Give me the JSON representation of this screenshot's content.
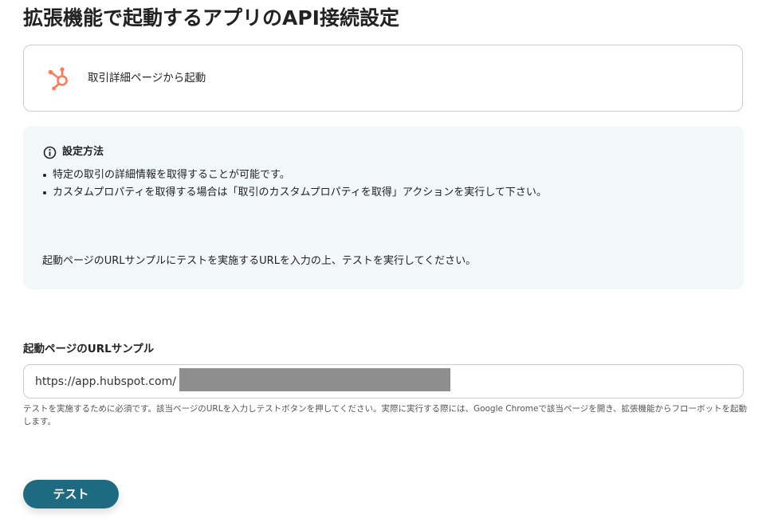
{
  "page": {
    "title": "拡張機能で起動するアプリのAPI接続設定"
  },
  "trigger": {
    "icon": "hubspot-logo-icon",
    "label": "取引詳細ページから起動",
    "icon_color": "#ff7a59"
  },
  "info": {
    "icon": "info-circle-icon",
    "title": "設定方法",
    "items": [
      "特定の取引の詳細情報を取得することが可能です。",
      "カスタムプロパティを取得する場合は「取引のカスタムプロパティを取得」アクションを実行して下さい。"
    ],
    "note": "起動ページのURLサンプルにテストを実施するURLを入力の上、テストを実行してください。",
    "background_color": "#f1f8f7"
  },
  "url_field": {
    "label": "起動ページのURLサンプル",
    "value": "https://app.hubspot.com/",
    "help": "テストを実施するために必須です。該当ページのURLを入力しテストボタンを押してください。実際に実行する際には、Google Chromeで該当ページを開き、拡張機能からフローボットを起動します。"
  },
  "test_button": {
    "label": "テスト",
    "color": "#1e6a80"
  }
}
